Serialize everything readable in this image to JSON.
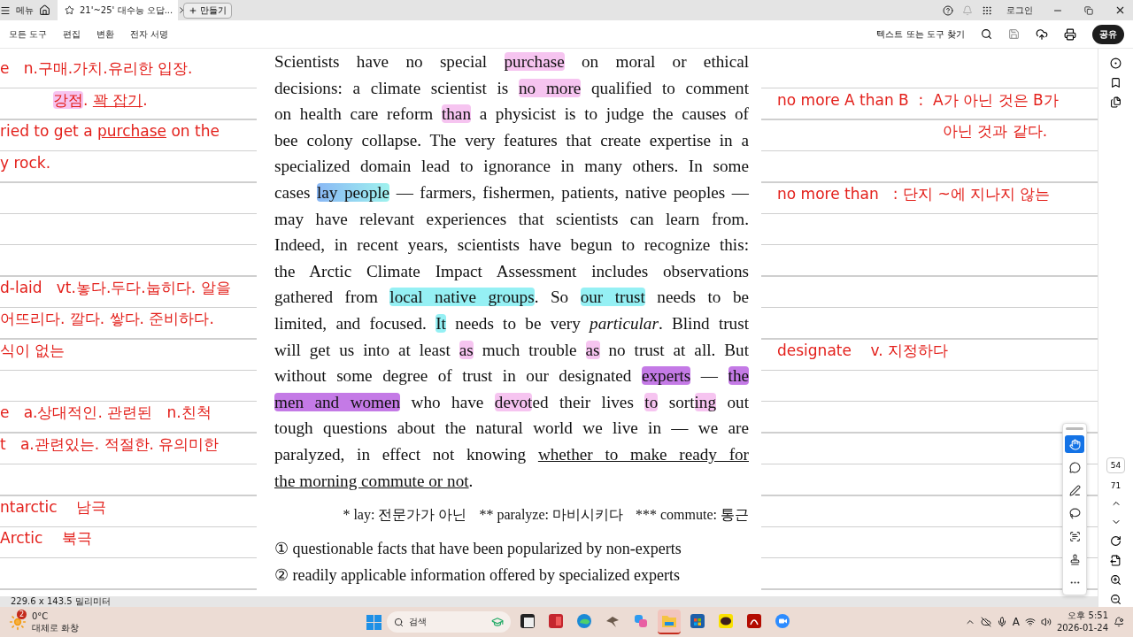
{
  "titlebar": {
    "menu": "메뉴",
    "tab_title": "21'~25' 대수능 오답...",
    "create": "만들기",
    "login": "로그인"
  },
  "toolbar": {
    "menus": [
      "모든 도구",
      "편집",
      "변환",
      "전자 서명"
    ],
    "search_label": "텍스트 또는 도구 찾기",
    "share": "공유"
  },
  "left_notes": [
    {
      "kind": "note",
      "segments": [
        {
          "t": "e   n.구매.가치.유리한 입장."
        }
      ]
    },
    {
      "kind": "indented",
      "segments": [
        {
          "t": "강점",
          "kind": "pink"
        },
        {
          "t": ". "
        },
        {
          "t": "꽉 잡기",
          "kind": "underline"
        },
        {
          "t": "."
        }
      ]
    },
    {
      "kind": "note",
      "segments": [
        {
          "t": "ried to get a "
        },
        {
          "t": "purchase",
          "kind": "underline"
        },
        {
          "t": " on the"
        }
      ]
    },
    {
      "kind": "note",
      "segments": [
        {
          "t": "y rock."
        }
      ]
    },
    {
      "kind": "blank"
    },
    {
      "kind": "blank"
    },
    {
      "kind": "blank"
    },
    {
      "kind": "note",
      "segments": [
        {
          "t": "d-laid   vt.놓다.두다.눕히다. 알을"
        }
      ]
    },
    {
      "kind": "note",
      "segments": [
        {
          "t": "어뜨리다. 깔다. 쌓다. 준비하다."
        }
      ]
    },
    {
      "kind": "note",
      "segments": [
        {
          "t": "식이 없는"
        }
      ]
    },
    {
      "kind": "blank"
    },
    {
      "kind": "note",
      "segments": [
        {
          "t": "e   a.상대적인. 관련된   n.친척"
        }
      ]
    },
    {
      "kind": "note",
      "segments": [
        {
          "t": "t   a.관련있는. 적절한. 유의미한"
        }
      ]
    },
    {
      "kind": "blank"
    },
    {
      "kind": "note",
      "segments": [
        {
          "t": "ntarctic    남극"
        }
      ]
    },
    {
      "kind": "note",
      "segments": [
        {
          "t": "Arctic    북극"
        }
      ]
    }
  ],
  "passage": [
    [
      {
        "t": "Scientists have no special "
      },
      {
        "t": "purchase",
        "kind": "pink"
      },
      {
        "t": " on moral or ethical"
      }
    ],
    [
      {
        "t": "decisions: a climate scientist is "
      },
      {
        "t": "no more",
        "kind": "pink"
      },
      {
        "t": " qualified to comment"
      }
    ],
    [
      {
        "t": "on health care reform "
      },
      {
        "t": "than",
        "kind": "pink"
      },
      {
        "t": " a physicist is to judge the causes of"
      }
    ],
    [
      {
        "t": "bee colony collapse. The very features that create expertise in a"
      }
    ],
    [
      {
        "t": "specialized domain lead to ignorance in many others. In some"
      }
    ],
    [
      {
        "t": "cases "
      },
      {
        "t": "lay people",
        "kind": "blue"
      },
      {
        "t": " — farmers, fishermen, patients, native peoples —"
      }
    ],
    [
      {
        "t": "may have relevant experiences that scientists can learn from."
      }
    ],
    [
      {
        "t": "Indeed, in recent years, scientists have begun to recognize this:"
      }
    ],
    [
      {
        "t": "the Arctic Climate Impact Assessment includes observations"
      }
    ],
    [
      {
        "t": "gathered from "
      },
      {
        "t": "local native groups",
        "kind": "cyan"
      },
      {
        "t": ". So "
      },
      {
        "t": "our trust",
        "kind": "cyan"
      },
      {
        "t": " needs to be"
      }
    ],
    [
      {
        "t": "limited, and focused. "
      },
      {
        "t": "It",
        "kind": "cyan"
      },
      {
        "t": " needs to be very *particular*. Blind trust"
      }
    ],
    [
      {
        "t": "will get us into at least "
      },
      {
        "t": "as",
        "kind": "pink"
      },
      {
        "t": " much trouble "
      },
      {
        "t": "as",
        "kind": "pink"
      },
      {
        "t": " no trust at all. But"
      }
    ],
    [
      {
        "t": "without some degree of trust in our designated "
      },
      {
        "t": "experts",
        "kind": "purple"
      },
      {
        "t": " — "
      },
      {
        "t": "the",
        "kind": "purple"
      }
    ],
    [
      {
        "t": "men and women",
        "kind": "purple"
      },
      {
        "t": " who have "
      },
      {
        "t": "devot",
        "kind": "pink"
      },
      {
        "t": "ed their lives "
      },
      {
        "t": "to",
        "kind": "pink"
      },
      {
        "t": " sort"
      },
      {
        "t": "ing",
        "kind": "pink"
      },
      {
        "t": " out"
      }
    ],
    [
      {
        "t": "tough questions about the natural world we live in — we are"
      }
    ],
    [
      {
        "t": "paralyzed, in effect not knowing "
      },
      {
        "t": "whether to make ready for",
        "kind": "underline"
      }
    ],
    [
      {
        "t": "the morning commute or not",
        "kind": "underline"
      },
      {
        "t": "."
      }
    ]
  ],
  "footnotes": [
    "* lay: 전문가가 아닌",
    "** paralyze: 마비시키다",
    "*** commute: 통근"
  ],
  "options": [
    {
      "mark": "①",
      "text": "questionable facts that have been popularized by non-experts"
    },
    {
      "mark": "②",
      "text": "readily applicable information offered by specialized experts"
    }
  ],
  "right_notes": [
    {
      "kind": "blank"
    },
    {
      "kind": "note",
      "segments": [
        {
          "t": "no more A than B  :  A가 아닌 것은 B가"
        }
      ]
    },
    {
      "kind": "indented",
      "segments": [
        {
          "t": "아닌 것과 같다."
        }
      ]
    },
    {
      "kind": "blank"
    },
    {
      "kind": "note",
      "segments": [
        {
          "t": "no more than   : 단지 ~에 지나지 않는"
        }
      ]
    },
    {
      "kind": "blank"
    },
    {
      "kind": "blank"
    },
    {
      "kind": "blank"
    },
    {
      "kind": "blank"
    },
    {
      "kind": "note",
      "segments": [
        {
          "t": "designate    v. 지정하다"
        }
      ]
    }
  ],
  "tools": [
    {
      "kind": "hand",
      "selected": true
    },
    {
      "kind": "comment",
      "selected": false
    },
    {
      "kind": "pen",
      "selected": false
    },
    {
      "kind": "lasso",
      "selected": false
    },
    {
      "kind": "textbox",
      "selected": false
    },
    {
      "kind": "stamp",
      "selected": false
    },
    {
      "kind": "more",
      "selected": false
    }
  ],
  "page_nav": {
    "current": "54",
    "total": "71"
  },
  "status": "229.6 x 143.5 밀리미터",
  "taskbar": {
    "weather_badge": "2",
    "temperature": "0°C",
    "weather": "대체로 화창",
    "search": "검색",
    "apps": [
      {
        "kind": "terminal",
        "selected": false
      },
      {
        "kind": "slides",
        "selected": false
      },
      {
        "kind": "browser",
        "selected": false
      },
      {
        "kind": "bird",
        "selected": false
      },
      {
        "kind": "copilot",
        "selected": false
      },
      {
        "kind": "folder",
        "selected": true
      },
      {
        "kind": "store",
        "selected": false
      },
      {
        "kind": "chat",
        "selected": false
      },
      {
        "kind": "pdf",
        "selected": false
      },
      {
        "kind": "video",
        "selected": false
      }
    ],
    "ime": "A",
    "time": "오후 5:51",
    "date": "2026-01-24"
  }
}
